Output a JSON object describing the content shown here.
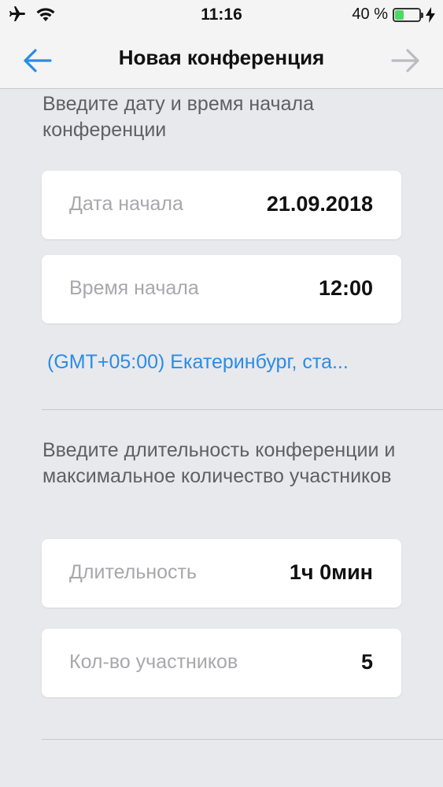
{
  "status_bar": {
    "time": "11:16",
    "battery_percent_text": "40 %",
    "battery_level": 0.4,
    "icons": [
      "airplane-icon",
      "wifi-icon",
      "battery-icon",
      "charging-bolt-icon"
    ],
    "battery_color": "#4cd964"
  },
  "nav": {
    "title": "Новая конференция",
    "back_icon": "arrow-left-icon",
    "forward_icon": "arrow-right-icon",
    "accent_color": "#2a8ce6",
    "disabled_color": "#bcbcc0"
  },
  "section_datetime": {
    "prompt": "Введите дату и время начала конференции",
    "start_date": {
      "label": "Дата начала",
      "value": "21.09.2018"
    },
    "start_time": {
      "label": "Время начала",
      "value": "12:00"
    },
    "timezone": "(GMT+05:00) Екатеринбург, ста..."
  },
  "section_duration": {
    "prompt": "Введите длительность конференции и максимальное количество участников",
    "duration": {
      "label": "Длительность",
      "value": "1ч 0мин"
    },
    "participants": {
      "label": "Кол-во участников",
      "value": "5"
    }
  }
}
